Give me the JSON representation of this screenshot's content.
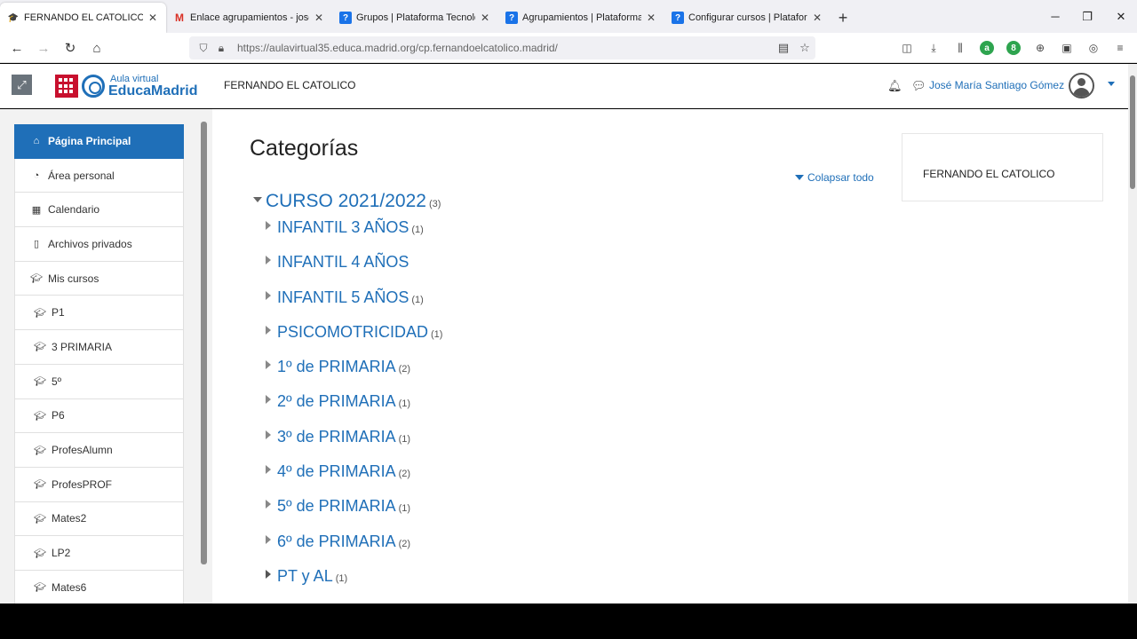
{
  "tabs": [
    {
      "title": "FERNANDO EL CATOLICO",
      "icon": "graduation-cap-icon",
      "active": true
    },
    {
      "title": "Enlace agrupamientos - josema",
      "icon": "gmail-icon",
      "active": false
    },
    {
      "title": "Grupos | Plataforma Tecnológic",
      "icon": "help-icon",
      "active": false
    },
    {
      "title": "Agrupamientos | Plataforma Te",
      "icon": "help-icon",
      "active": false
    },
    {
      "title": "Configurar cursos | Plataforma T",
      "icon": "help-icon",
      "active": false
    }
  ],
  "url": "https://aulavirtual35.educa.madrid.org/cp.fernandoelcatolico.madrid/",
  "header": {
    "logo_small": "Aula virtual",
    "logo_big": "EducaMadrid",
    "site_name": "FERNANDO EL CATOLICO",
    "user_name": "José María Santiago Gómez"
  },
  "sidebar": {
    "items": [
      {
        "label": "Página Principal",
        "icon": "home-icon"
      },
      {
        "label": "Área personal",
        "icon": "dashboard-icon"
      },
      {
        "label": "Calendario",
        "icon": "calendar-icon"
      },
      {
        "label": "Archivos privados",
        "icon": "file-icon"
      },
      {
        "label": "Mis cursos",
        "icon": "graduation-cap-icon"
      },
      {
        "label": "P1",
        "icon": "graduation-cap-icon"
      },
      {
        "label": "3 PRIMARIA",
        "icon": "graduation-cap-icon"
      },
      {
        "label": "5º",
        "icon": "graduation-cap-icon"
      },
      {
        "label": "P6",
        "icon": "graduation-cap-icon"
      },
      {
        "label": "ProfesAlumn",
        "icon": "graduation-cap-icon"
      },
      {
        "label": "ProfesPROF",
        "icon": "graduation-cap-icon"
      },
      {
        "label": "Mates2",
        "icon": "graduation-cap-icon"
      },
      {
        "label": "LP2",
        "icon": "graduation-cap-icon"
      },
      {
        "label": "Mates6",
        "icon": "graduation-cap-icon"
      }
    ]
  },
  "main": {
    "title": "Categorías",
    "collapse_all": "Colapsar todo",
    "root_category": {
      "name": "CURSO 2021/2022",
      "count": "(3)"
    },
    "categories": [
      {
        "name": "INFANTIL 3 AÑOS",
        "count": "(1)"
      },
      {
        "name": "INFANTIL 4 AÑOS",
        "count": ""
      },
      {
        "name": "INFANTIL 5 AÑOS",
        "count": "(1)"
      },
      {
        "name": "PSICOMOTRICIDAD",
        "count": "(1)"
      },
      {
        "name": "1º de PRIMARIA",
        "count": "(2)"
      },
      {
        "name": "2º de PRIMARIA",
        "count": "(1)"
      },
      {
        "name": "3º de PRIMARIA",
        "count": "(1)"
      },
      {
        "name": "4º de PRIMARIA",
        "count": "(2)"
      },
      {
        "name": "5º de PRIMARIA",
        "count": "(1)"
      },
      {
        "name": "6º de PRIMARIA",
        "count": "(2)"
      },
      {
        "name": "PT y AL",
        "count": "(1)"
      }
    ]
  },
  "block": {
    "text": "FERNANDO EL CATOLICO"
  },
  "colors": {
    "primary": "#1f6fb8",
    "active_nav": "#1f6fb8",
    "page_bg": "#f2f2f2"
  }
}
